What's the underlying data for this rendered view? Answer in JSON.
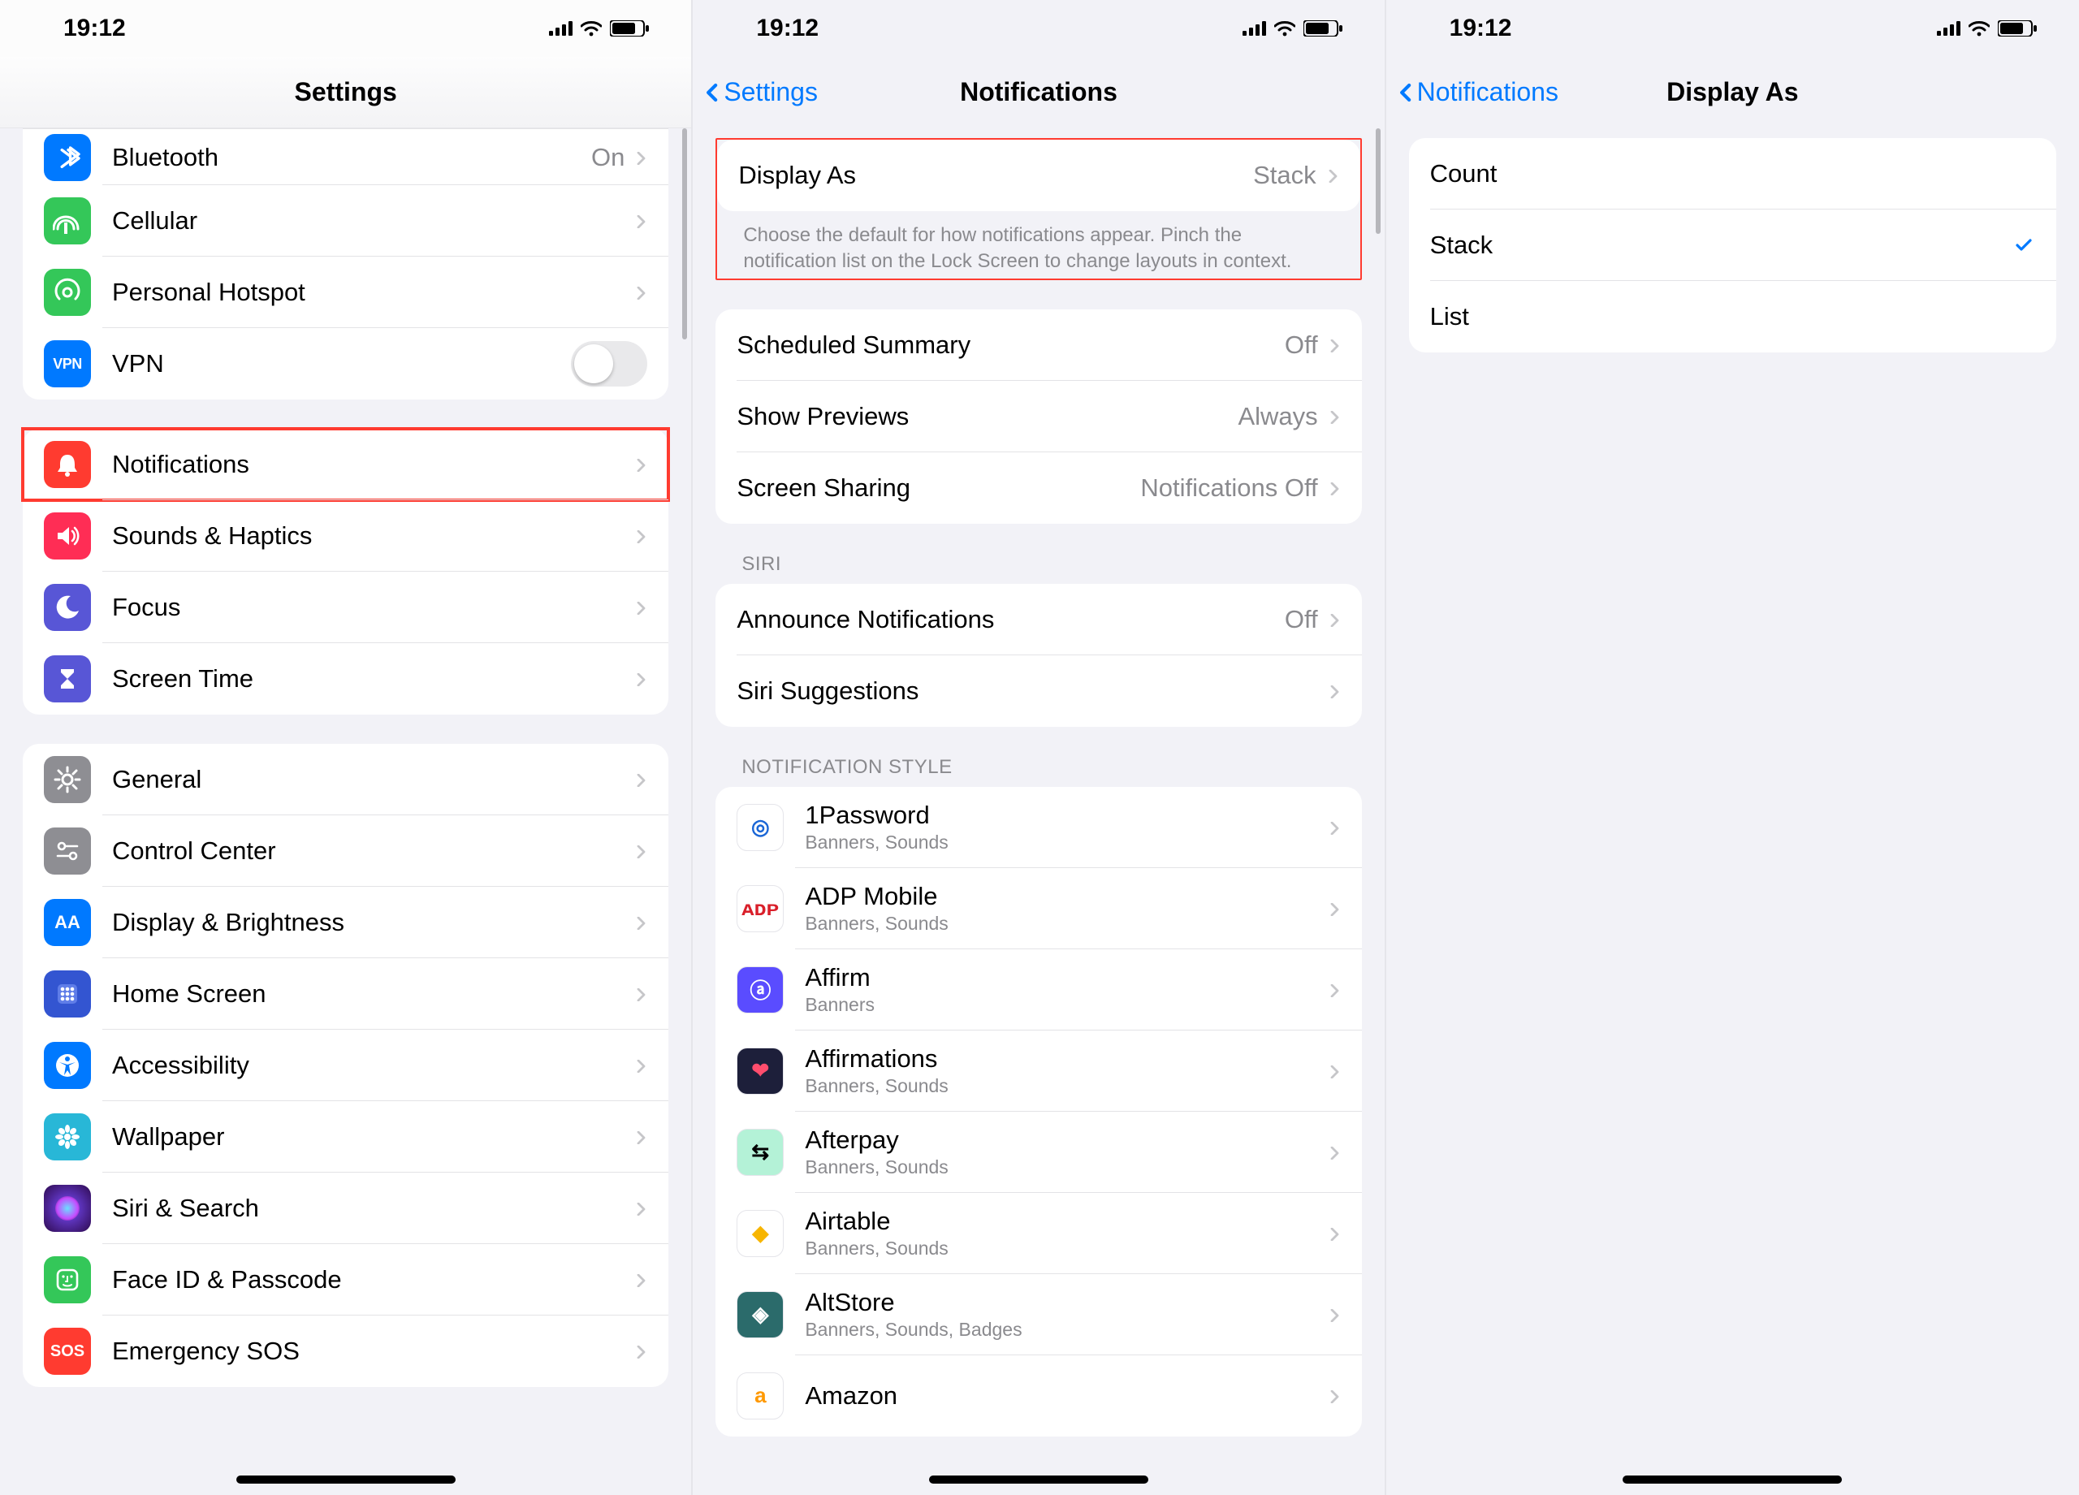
{
  "status": {
    "time": "19:12"
  },
  "screen1": {
    "title": "Settings",
    "groups": {
      "connectivity": [
        {
          "icon": "bluetooth",
          "bg": "#0079ff",
          "label": "Bluetooth",
          "value": "On"
        },
        {
          "icon": "cellular",
          "bg": "#34c759",
          "label": "Cellular"
        },
        {
          "icon": "hotspot",
          "bg": "#34c759",
          "label": "Personal Hotspot"
        },
        {
          "icon": "vpn",
          "bg": "#0079ff",
          "label": "VPN",
          "toggle": true
        }
      ],
      "attention": [
        {
          "icon": "bell",
          "bg": "#ff3b30",
          "label": "Notifications",
          "highlight": true
        },
        {
          "icon": "speaker",
          "bg": "#ff2d55",
          "label": "Sounds & Haptics"
        },
        {
          "icon": "moon",
          "bg": "#5856d6",
          "label": "Focus"
        },
        {
          "icon": "hourglass",
          "bg": "#5856d6",
          "label": "Screen Time"
        }
      ],
      "general": [
        {
          "icon": "gear",
          "bg": "#8e8e93",
          "label": "General"
        },
        {
          "icon": "switches",
          "bg": "#8e8e93",
          "label": "Control Center"
        },
        {
          "icon": "aa",
          "bg": "#0079ff",
          "label": "Display & Brightness"
        },
        {
          "icon": "grid",
          "bg": "#3355d1",
          "label": "Home Screen"
        },
        {
          "icon": "accessibility",
          "bg": "#0079ff",
          "label": "Accessibility"
        },
        {
          "icon": "flower",
          "bg": "#28b7d7",
          "label": "Wallpaper"
        },
        {
          "icon": "siri",
          "bg": "#111",
          "label": "Siri & Search"
        },
        {
          "icon": "faceid",
          "bg": "#34c759",
          "label": "Face ID & Passcode"
        },
        {
          "icon": "sos",
          "bg": "#ff3b30",
          "label": "Emergency SOS"
        }
      ]
    }
  },
  "screen2": {
    "title": "Notifications",
    "back": "Settings",
    "display_as": {
      "label": "Display As",
      "value": "Stack"
    },
    "display_footer": "Choose the default for how notifications appear. Pinch the notification list on the Lock Screen to change layouts in context.",
    "group2": [
      {
        "label": "Scheduled Summary",
        "value": "Off"
      },
      {
        "label": "Show Previews",
        "value": "Always"
      },
      {
        "label": "Screen Sharing",
        "value": "Notifications Off"
      }
    ],
    "siri_header": "SIRI",
    "siri": [
      {
        "label": "Announce Notifications",
        "value": "Off"
      },
      {
        "label": "Siri Suggestions"
      }
    ],
    "style_header": "NOTIFICATION STYLE",
    "apps": [
      {
        "name": "1Password",
        "detail": "Banners, Sounds",
        "bg": "#ffffff",
        "fg": "#1a66d6",
        "glyph": "◎"
      },
      {
        "name": "ADP Mobile",
        "detail": "Banners, Sounds",
        "bg": "#ffffff",
        "fg": "#d91f2a",
        "glyph": "ᴀᴅᴘ"
      },
      {
        "name": "Affirm",
        "detail": "Banners",
        "bg": "#5a4cff",
        "fg": "#ffffff",
        "glyph": "ⓐ"
      },
      {
        "name": "Affirmations",
        "detail": "Banners, Sounds",
        "bg": "#1d1f3a",
        "fg": "#ff4d6d",
        "glyph": "❤"
      },
      {
        "name": "Afterpay",
        "detail": "Banners, Sounds",
        "bg": "#b4f2d7",
        "fg": "#000000",
        "glyph": "⇆"
      },
      {
        "name": "Airtable",
        "detail": "Banners, Sounds",
        "bg": "#ffffff",
        "fg": "#f7b500",
        "glyph": "◆"
      },
      {
        "name": "AltStore",
        "detail": "Banners, Sounds, Badges",
        "bg": "#2b6b6b",
        "fg": "#ffffff",
        "glyph": "◈"
      },
      {
        "name": "Amazon",
        "detail": "",
        "bg": "#ffffff",
        "fg": "#ff9900",
        "glyph": "a"
      }
    ]
  },
  "screen3": {
    "title": "Display As",
    "back": "Notifications",
    "options": [
      {
        "label": "Count",
        "selected": false
      },
      {
        "label": "Stack",
        "selected": true
      },
      {
        "label": "List",
        "selected": false
      }
    ]
  }
}
